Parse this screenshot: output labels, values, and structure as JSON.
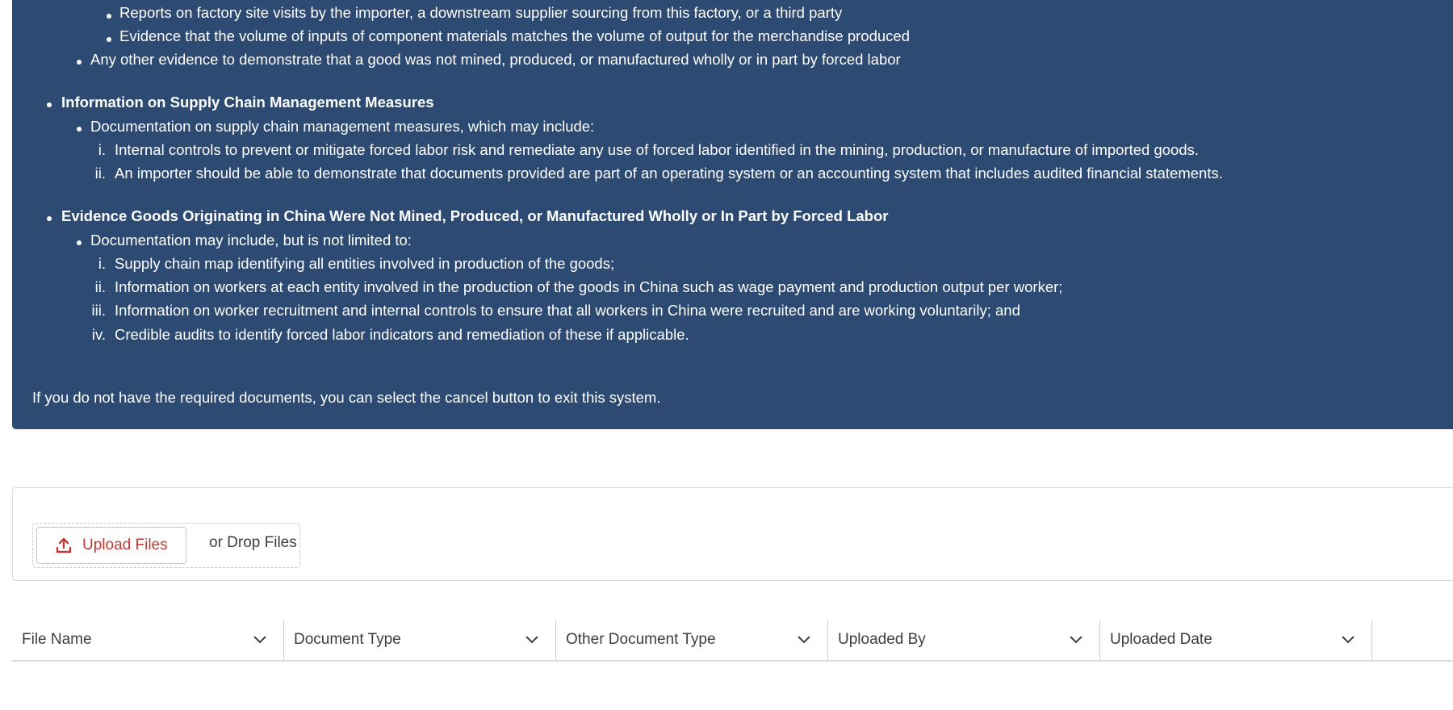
{
  "info": {
    "sub_items_top": [
      "Reports on factory site visits by the importer, a downstream supplier sourcing from this factory, or a third party",
      "Evidence that the volume of inputs of component materials matches the volume of output for the merchandise produced"
    ],
    "other_evidence": "Any other evidence to demonstrate that a good was not mined, produced, or manufactured wholly or in part by forced labor",
    "section1": {
      "heading": "Information on Supply Chain Management Measures",
      "bullet": "Documentation on supply chain management measures, which may include:",
      "items": [
        {
          "num": "i.",
          "text": "Internal controls to prevent or mitigate forced labor risk and remediate any use of forced labor identified in the mining, production, or manufacture of imported goods."
        },
        {
          "num": "ii.",
          "text": "An importer should be able to demonstrate that documents provided are part of an operating system or an accounting system that includes audited financial statements."
        }
      ]
    },
    "section2": {
      "heading": "Evidence Goods Originating in China Were Not Mined, Produced, or Manufactured Wholly or In Part by Forced Labor",
      "bullet": "Documentation may include, but is not limited to:",
      "items": [
        {
          "num": "i.",
          "text": "Supply chain map identifying all entities involved in production of the goods;"
        },
        {
          "num": "ii.",
          "text": "Information on workers at each entity involved in the production of the goods in China such as wage payment and production output per worker;"
        },
        {
          "num": "iii.",
          "text": "Information on worker recruitment and internal controls to ensure that all workers in China were recruited and are working voluntarily; and"
        },
        {
          "num": "iv.",
          "text": "Credible audits to identify forced labor indicators and remediation of these if applicable."
        }
      ]
    },
    "footer_note": "If you do not have the required documents, you can select the cancel button to exit this system."
  },
  "upload": {
    "button_label": "Upload Files",
    "drop_label": "or Drop Files",
    "icon": "upload-icon"
  },
  "table": {
    "columns": [
      {
        "label": "File Name"
      },
      {
        "label": "Document Type"
      },
      {
        "label": "Other Document Type"
      },
      {
        "label": "Uploaded By"
      },
      {
        "label": "Uploaded Date"
      }
    ]
  },
  "colors": {
    "panel_bg": "#2c4a72",
    "accent_red": "#c23934",
    "border": "#dddbda"
  }
}
